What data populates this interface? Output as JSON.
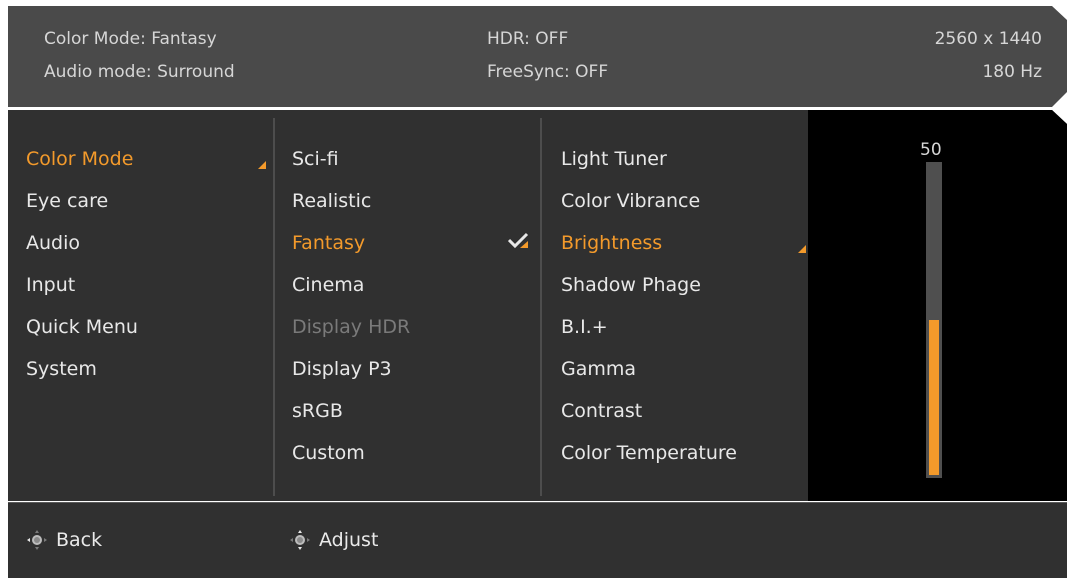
{
  "header": {
    "color_mode": "Color Mode: Fantasy",
    "audio_mode": "Audio mode: Surround",
    "hdr": "HDR: OFF",
    "freesync": "FreeSync: OFF",
    "resolution": "2560 x 1440",
    "refresh_rate": "180 Hz"
  },
  "menu": {
    "main": [
      "Color Mode",
      "Eye care",
      "Audio",
      "Input",
      "Quick Menu",
      "System"
    ],
    "main_selected": "Color Mode",
    "modes": [
      "Sci-fi",
      "Realistic",
      "Fantasy",
      "Cinema",
      "Display HDR",
      "Display P3",
      "sRGB",
      "Custom"
    ],
    "modes_selected": "Fantasy",
    "modes_disabled": "Display HDR",
    "settings": [
      "Light Tuner",
      "Color Vibrance",
      "Brightness",
      "Shadow Phage",
      "B.I.+",
      "Gamma",
      "Contrast",
      "Color Temperature"
    ],
    "settings_selected": "Brightness"
  },
  "slider": {
    "value": "50",
    "level_fraction": 0.5
  },
  "footer": {
    "back": "Back",
    "adjust": "Adjust"
  },
  "colors": {
    "accent": "#f39a2b",
    "header_bg": "#4a4a4a",
    "panel_bg": "#303030",
    "slider_bg": "#000000"
  },
  "icons": {
    "footer_back": "joystick-left-icon",
    "footer_adjust": "joystick-up-down-icon",
    "selected_mode": "checkmark-icon",
    "submenu": "corner-arrow-icon"
  }
}
